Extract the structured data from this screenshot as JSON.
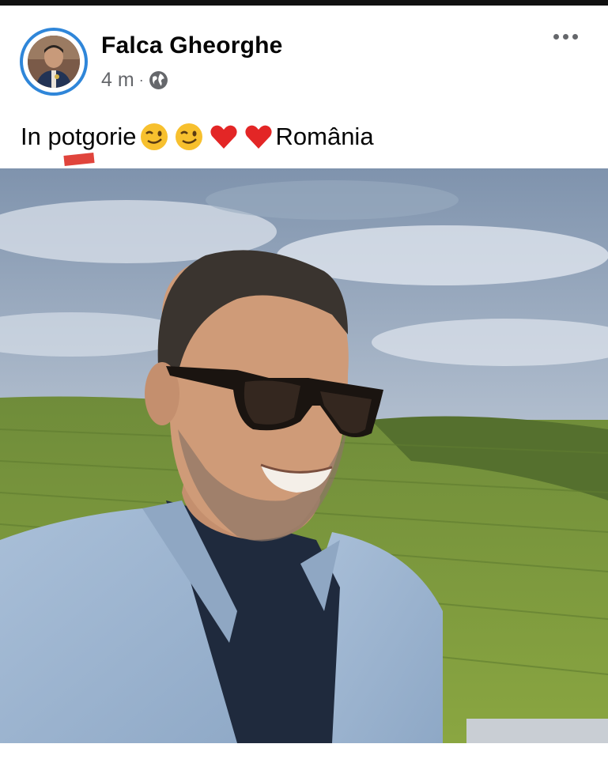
{
  "post": {
    "author": "Falca Gheorghe",
    "time": "4 m",
    "separator": "·",
    "privacy_icon": "globe-icon",
    "more_icon": "ellipsis-icon",
    "caption": {
      "before": "In potgorie",
      "emojis": [
        "winking-face",
        "winking-face",
        "red-heart",
        "red-heart"
      ],
      "after": "România"
    }
  },
  "colors": {
    "avatar_ring": "#2f86d9",
    "meta_text": "#65676b",
    "annotation_mark": "#e0443c"
  }
}
